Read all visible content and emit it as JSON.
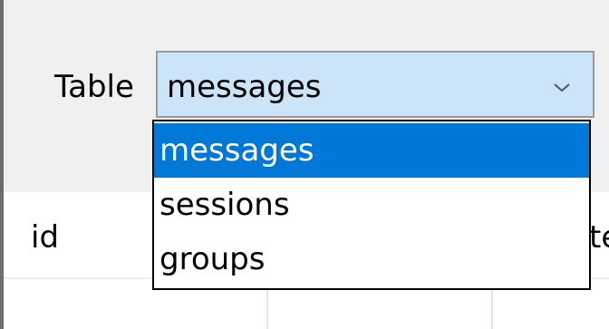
{
  "toolbar": {
    "table_label": "Table",
    "table_select": {
      "value": "messages",
      "options": [
        "messages",
        "sessions",
        "groups"
      ],
      "selected_index": 0
    }
  },
  "grid": {
    "columns": [
      "id",
      "",
      "te"
    ]
  },
  "colors": {
    "select_background": "#cce4f7",
    "selected_option": "#0078d7",
    "toolbar_background": "#f0f0f0"
  },
  "icons": {
    "select_chevron": "chevron-down-icon"
  }
}
